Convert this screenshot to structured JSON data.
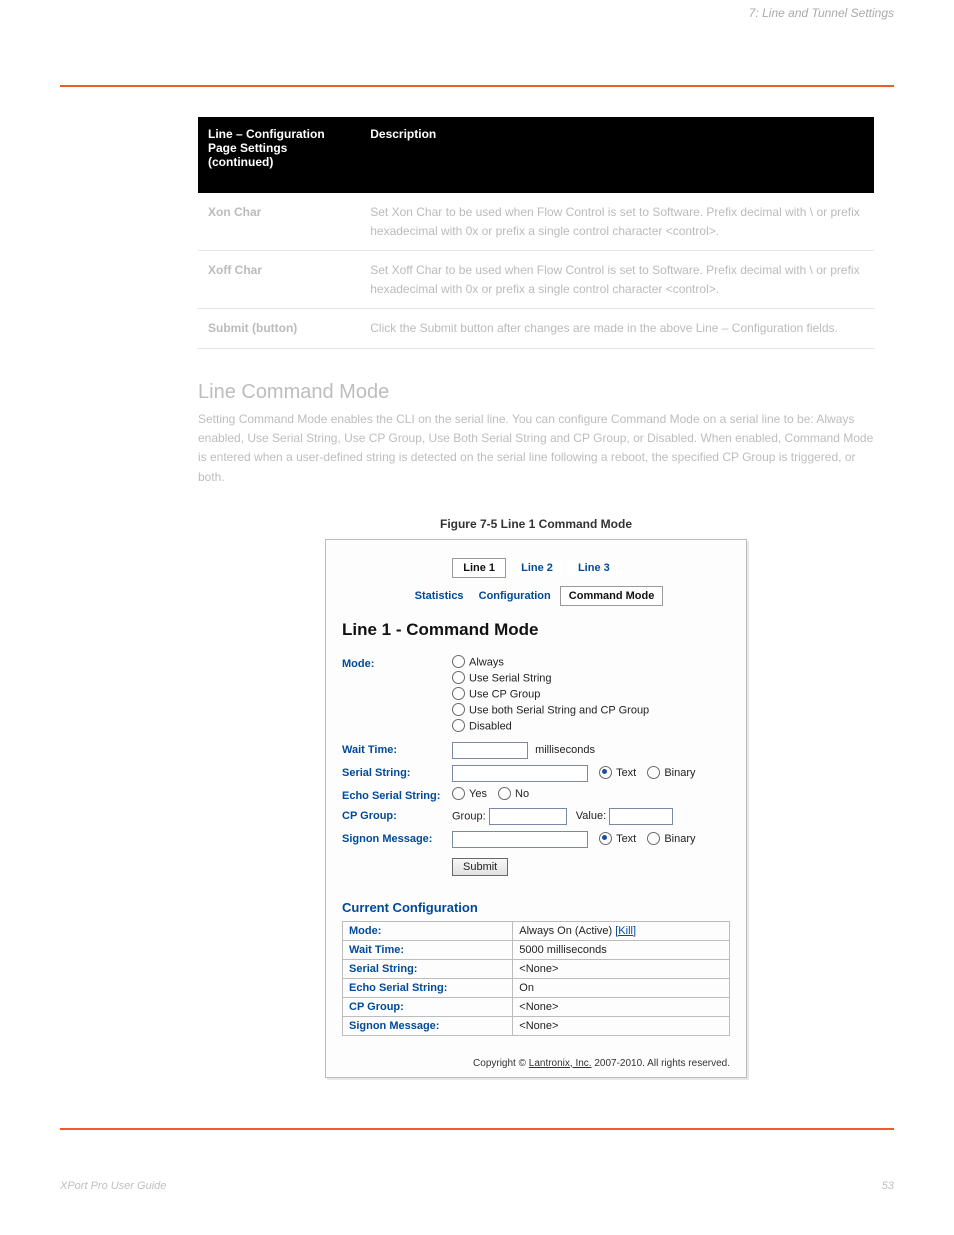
{
  "page_header_right": "7: Line and Tunnel Settings",
  "defs_table": {
    "headers": [
      "Line – Configuration Page Settings (continued)",
      "Description"
    ],
    "rows": [
      {
        "field": "Xon Char",
        "desc": "Set Xon Char to be used when Flow Control is set to Software. Prefix decimal with \\ or prefix hexadecimal with 0x or prefix a single control character <control>."
      },
      {
        "field": "Xoff Char",
        "desc": "Set Xoff Char to be used when Flow Control is set to Software. Prefix decimal with \\ or prefix hexadecimal with 0x or prefix a single control character <control>."
      },
      {
        "field": "Submit (button)",
        "desc": "Click the Submit button after changes are made in the above Line – Configuration fields."
      }
    ]
  },
  "subhead": "Line Command Mode",
  "blurb": "Setting Command Mode enables the CLI on the serial line. You can configure Command Mode on a serial line to be: Always enabled, Use Serial String, Use CP Group, Use Both Serial String and CP Group, or Disabled. When enabled, Command Mode is entered when a user-defined string is detected on the serial line following a reboot, the specified CP Group is triggered, or both.",
  "figure_label": "Figure 7-5  Line 1 Command Mode",
  "shot": {
    "line_tabs": [
      "Line 1",
      "Line 2",
      "Line 3"
    ],
    "sub_tabs": {
      "stats": "Statistics",
      "config": "Configuration",
      "cmd": "Command Mode"
    },
    "pane_title": "Line 1 - Command Mode",
    "labels": {
      "mode": "Mode:",
      "wait": "Wait Time:",
      "serial": "Serial String:",
      "echo": "Echo Serial String:",
      "cpg": "CP Group:",
      "signon": "Signon Message:"
    },
    "mode_options": [
      "Always",
      "Use Serial String",
      "Use CP Group",
      "Use both Serial String and CP Group",
      "Disabled"
    ],
    "wait_unit": "milliseconds",
    "tb_text": "Text",
    "tb_bin": "Binary",
    "yes": "Yes",
    "no": "No",
    "group_lbl": "Group:",
    "value_lbl": "Value:",
    "submit": "Submit",
    "cc_title": "Current Configuration",
    "cc_rows": [
      {
        "k": "Mode:",
        "v": "Always On (Active)  ",
        "kill": "[Kill]"
      },
      {
        "k": "Wait Time:",
        "v": "5000 milliseconds"
      },
      {
        "k": "Serial String:",
        "v": "<None>"
      },
      {
        "k": "Echo Serial String:",
        "v": "On"
      },
      {
        "k": "CP Group:",
        "v": "<None>"
      },
      {
        "k": "Signon Message:",
        "v": "<None>"
      }
    ],
    "copyright_pre": "Copyright © ",
    "copyright_link": "Lantronix, Inc.",
    "copyright_post": " 2007-2010. All rights reserved."
  },
  "footer_left": "XPort Pro User Guide",
  "footer_right": "53"
}
